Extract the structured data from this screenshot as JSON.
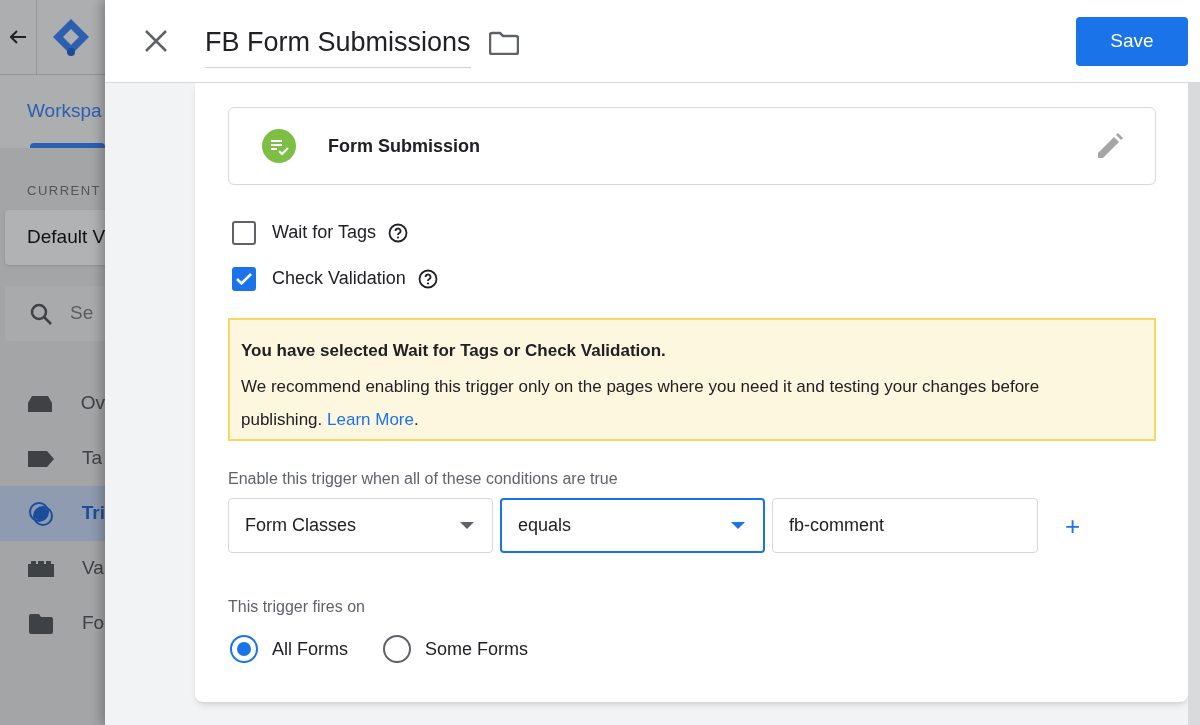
{
  "sidebar": {
    "tab": {
      "label": "Workspa",
      "selected": true
    },
    "workspace_heading": "CURRENT",
    "workspace": "Default V",
    "search": {
      "placeholder": "Se"
    },
    "nav": [
      {
        "kind": "overview",
        "label": "Ov",
        "selected": false
      },
      {
        "kind": "tags",
        "label": "Ta",
        "selected": false
      },
      {
        "kind": "triggers",
        "label": "Tri",
        "selected": true
      },
      {
        "kind": "variables",
        "label": "Va",
        "selected": false
      },
      {
        "kind": "folders",
        "label": "Fo",
        "selected": false
      }
    ]
  },
  "dialog": {
    "title": "FB Form Submissions",
    "save": "Save",
    "trigger_type": {
      "name": "Form Submission"
    },
    "options": [
      {
        "label": "Wait for Tags",
        "checked": false
      },
      {
        "label": "Check Validation",
        "checked": true
      }
    ],
    "notice": {
      "title": "You have selected Wait for Tags or Check Validation.",
      "text": "We recommend enabling this trigger only on the pages where you need it and testing your changes before publishing.",
      "link": "Learn More",
      "after": "."
    },
    "conditions": {
      "label": "Enable this trigger when all of these conditions are true",
      "fields": [
        {
          "kind": "select",
          "value": "Form Classes",
          "focused": false
        },
        {
          "kind": "select",
          "value": "equals",
          "focused": true
        },
        {
          "kind": "text",
          "value": "fb-comment"
        }
      ],
      "add": "+"
    },
    "fires_on": {
      "label": "This trigger fires on",
      "options": [
        {
          "label": "All Forms",
          "selected": true
        },
        {
          "label": "Some Forms",
          "selected": false
        }
      ]
    }
  }
}
